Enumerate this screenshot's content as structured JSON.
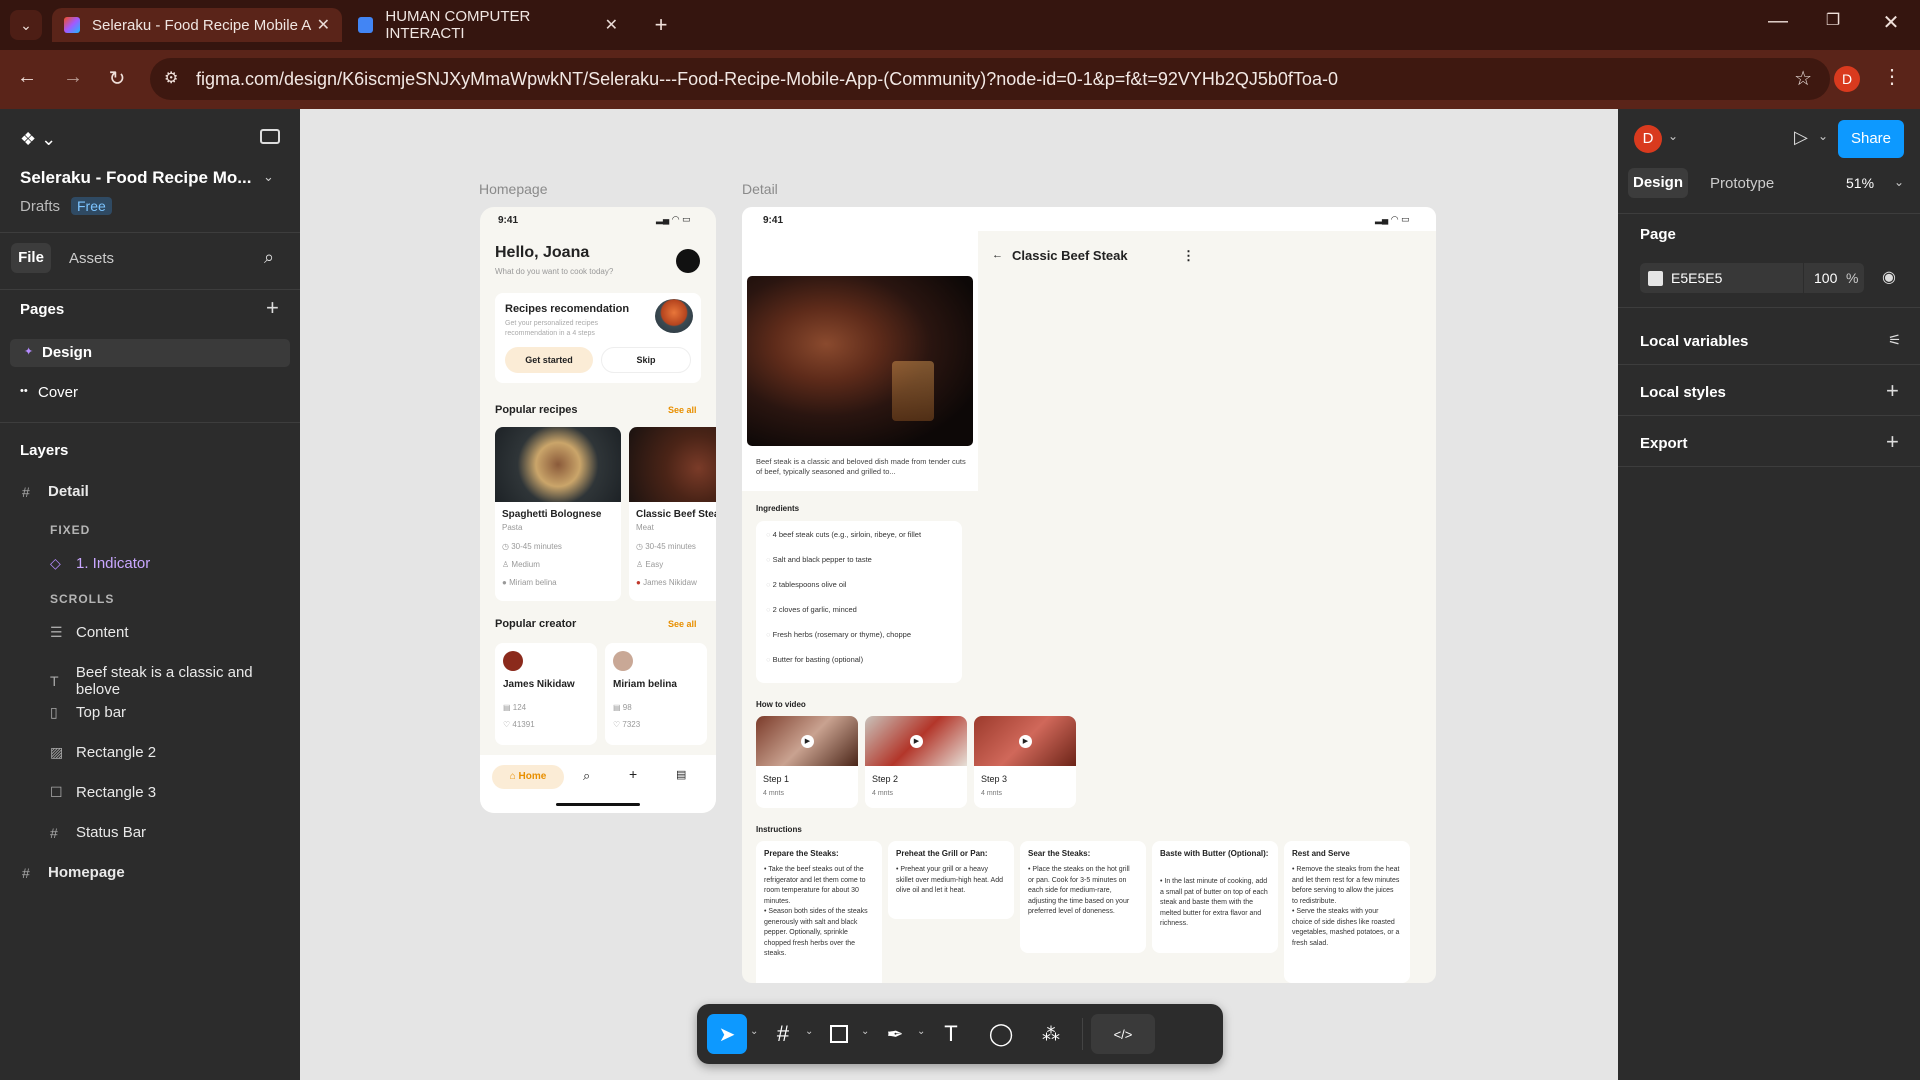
{
  "browser": {
    "tabs": [
      {
        "label": "Seleraku - Food Recipe Mobile A"
      },
      {
        "label": "HUMAN COMPUTER INTERACTI"
      }
    ],
    "url": "figma.com/design/K6iscmjeSNJXyMmaWpwkNT/Seleraku---Food-Recipe-Mobile-App-(Community)?node-id=0-1&p=f&t=92VYHb2QJ5b0fToa-0",
    "profile_initial": "D"
  },
  "left": {
    "file_title": "Seleraku - Food Recipe Mo...",
    "drafts": "Drafts",
    "plan": "Free",
    "tab_file": "File",
    "tab_assets": "Assets",
    "pages_heading": "Pages",
    "pages": [
      {
        "label": "Design"
      },
      {
        "label": "Cover"
      }
    ],
    "layers_heading": "Layers",
    "layers": [
      {
        "label": "Detail",
        "icon": "#"
      },
      {
        "label": "FIXED",
        "section": true
      },
      {
        "label": "1. Indicator",
        "icon": "◇"
      },
      {
        "label": "SCROLLS",
        "section": true
      },
      {
        "label": "Content",
        "icon": "☰"
      },
      {
        "label": "Beef steak is a classic and belove",
        "icon": "T"
      },
      {
        "label": "Top bar",
        "icon": "▯"
      },
      {
        "label": "Rectangle 2",
        "icon": "▨"
      },
      {
        "label": "Rectangle 3",
        "icon": "☐"
      },
      {
        "label": "Status Bar",
        "icon": "#"
      },
      {
        "label": "Homepage",
        "icon": "#"
      }
    ]
  },
  "right": {
    "avatar": "D",
    "share": "Share",
    "tab_design": "Design",
    "tab_prototype": "Prototype",
    "zoom": "51%",
    "page_heading": "Page",
    "page_color": "E5E5E5",
    "opacity": "100",
    "percent": "%",
    "local_variables": "Local variables",
    "local_styles": "Local styles",
    "export": "Export"
  },
  "canvas": {
    "home_label": "Homepage",
    "detail_label": "Detail",
    "home": {
      "time": "9:41",
      "greeting": "Hello, Joana",
      "sub": "What do you want to cook today?",
      "rec_title": "Recipes recomendation",
      "rec_sub": "Get your personalized recipes recommendation in a 4 steps",
      "get_started": "Get started",
      "skip": "Skip",
      "popular": "Popular recipes",
      "see_all": "See all",
      "recipes": [
        {
          "name": "Spaghetti Bolognese",
          "cat": "Pasta",
          "time": "30-45 minutes",
          "level": "Medium",
          "author": "Miriam belina"
        },
        {
          "name": "Classic Beef Steak",
          "cat": "Meat",
          "time": "30-45 minutes",
          "level": "Easy",
          "author": "James Nikidaw"
        }
      ],
      "popular_creator": "Popular creator",
      "see_all2": "See all",
      "creators": [
        {
          "name": "James Nikidaw",
          "recipes": "124",
          "likes": "41391"
        },
        {
          "name": "Miriam belina",
          "recipes": "98",
          "likes": "7323"
        }
      ],
      "nav_home": "Home"
    },
    "detail": {
      "time": "9:41",
      "title": "Classic Beef Steak",
      "desc": "Beef steak is a classic and beloved dish made from tender cuts of beef, typically seasoned and grilled to...",
      "ingredients_heading": "Ingredients",
      "ingredients": [
        "4 beef steak cuts (e.g., sirloin, ribeye, or fillet",
        "Salt and black pepper to taste",
        "2 tablespoons olive oil",
        "2 cloves of garlic, minced",
        "Fresh herbs (rosemary or thyme), choppe",
        "Butter for basting (optional)"
      ],
      "video_heading": "How to video",
      "videos": [
        {
          "step": "Step 1",
          "mins": "4 mnts"
        },
        {
          "step": "Step 2",
          "mins": "4 mnts"
        },
        {
          "step": "Step 3",
          "mins": "4 mnts"
        }
      ],
      "instructions_heading": "Instructions",
      "instructions": [
        {
          "title": "Prepare the Steaks:",
          "body": "• Take the beef steaks out of the refrigerator and let them come to room temperature for about 30 minutes.\n• Season both sides of the steaks generously with salt and black pepper. Optionally, sprinkle chopped fresh herbs over the steaks."
        },
        {
          "title": "Preheat the Grill or Pan:",
          "body": "• Preheat your grill or a heavy skillet over medium-high heat. Add olive oil and let it heat."
        },
        {
          "title": "Sear the Steaks:",
          "body": "• Place the steaks on the hot grill or pan. Cook for 3-5 minutes on each side for medium-rare, adjusting the time based on your preferred level of doneness."
        },
        {
          "title": "Baste with Butter (Optional):",
          "body": "• In the last minute of cooking, add a small pat of butter on top of each steak and baste them with the melted butter for extra flavor and richness."
        },
        {
          "title": "Rest and Serve",
          "body": "• Remove the steaks from the heat and let them rest for a few minutes before serving to allow the juices to redistribute.\n• Serve the steaks with your choice of side dishes like roasted vegetables, mashed potatoes, or a fresh salad."
        }
      ]
    }
  },
  "colors": {
    "accent": "#0d99ff",
    "orange": "#e88f00",
    "chrome_dark": "#35150f",
    "chrome": "#5a2419"
  }
}
